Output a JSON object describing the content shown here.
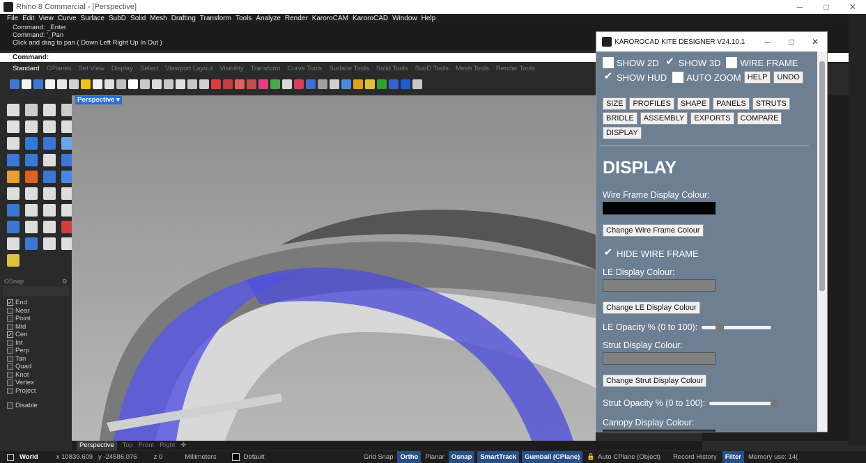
{
  "window": {
    "title": "Rhino 8 Commercial - [Perspective]",
    "min": "─",
    "max": "□",
    "close": "✕"
  },
  "menu": [
    "File",
    "Edit",
    "View",
    "Curve",
    "Surface",
    "SubD",
    "Solid",
    "Mesh",
    "Drafting",
    "Transform",
    "Tools",
    "Analyze",
    "Render",
    "KaroroCAM",
    "KaroroCAD",
    "Window",
    "Help"
  ],
  "command": {
    "history": [
      "Command: _Enter",
      "Command: '_Pan",
      "Click and drag to pan ( Down  Left  Right  Up  In  Out )"
    ],
    "prompt": "Command:"
  },
  "tabs": [
    "Standard",
    "CPlanes",
    "Set View",
    "Display",
    "Select",
    "Viewport Layout",
    "Visibility",
    "Transform",
    "Curve Tools",
    "Surface Tools",
    "Solid Tools",
    "SubD Tools",
    "Mesh Tools",
    "Render Tools"
  ],
  "toolbar_colors": [
    "#3a78d4",
    "#f2f2f2",
    "#3a78d4",
    "#f2f2f2",
    "#e8e8e8",
    "#d2d2d2",
    "#f0c020",
    "#f0f0f0",
    "#e0e0e0",
    "#c0c0c0",
    "#ffffff",
    "#c8c8c8",
    "#dcdcdc",
    "#c8c8c8",
    "#e0e0e0",
    "#c8c8c8",
    "#d0d0d0",
    "#d84040",
    "#c04040",
    "#e06060",
    "#c05050",
    "#e04080",
    "#4aa84a",
    "#d8d8d8",
    "#d84060",
    "#4070d0",
    "#a0a0a0",
    "#d0d0d0",
    "#4a8ae0",
    "#e0a020",
    "#e0c040",
    "#30a030",
    "#3a60d0",
    "#1f5ccf",
    "#c8c8c8"
  ],
  "left_colors": [
    "#ddd",
    "#ccc",
    "#ddd",
    "#ccc",
    "#e0e0e0",
    "#ddd",
    "#ddd",
    "#ddd",
    "#ddd",
    "#2f7bd8",
    "#3a78d4",
    "#6aa8e8",
    "#3a78d4",
    "#3a78d4",
    "#ddd",
    "#3a78d4",
    "#e8a030",
    "#e06020",
    "#3a78d4",
    "#4a88e8",
    "#ddd",
    "#ddd",
    "#ddd",
    "#ddd",
    "#3a78d4",
    "#ddd",
    "#ddd",
    "#ddd",
    "#3a78d4",
    "#ddd",
    "#ddd",
    "#d04040",
    "#ddd",
    "#3a78d4",
    "#ddd",
    "#ddd",
    "#e0c040"
  ],
  "viewport": {
    "label": "Perspective ▾",
    "tabs": [
      "Perspective",
      "Top",
      "Front",
      "Right",
      "✚"
    ]
  },
  "osnap": {
    "title": "OSnap",
    "gear": "⚙",
    "items": [
      {
        "label": "End",
        "checked": true
      },
      {
        "label": "Near",
        "checked": false
      },
      {
        "label": "Point",
        "checked": false
      },
      {
        "label": "Mid",
        "checked": false
      },
      {
        "label": "Cen",
        "checked": true
      },
      {
        "label": "Int",
        "checked": false
      },
      {
        "label": "Perp",
        "checked": false
      },
      {
        "label": "Tan",
        "checked": false
      },
      {
        "label": "Quad",
        "checked": false
      },
      {
        "label": "Knot",
        "checked": false
      },
      {
        "label": "Vertex",
        "checked": false
      },
      {
        "label": "Project",
        "checked": false
      }
    ],
    "disable": "Disable"
  },
  "status": {
    "cplane": "World",
    "x": "x 10839.609",
    "y": "y -24586.076",
    "z": "z 0",
    "units": "Millimeters",
    "layer": "Default",
    "grid": "Grid Snap",
    "ortho": "Ortho",
    "planar": "Planar",
    "osnap": "Osnap",
    "smart": "SmartTrack",
    "gumball": "Gumball (CPlane)",
    "autocplane": "Auto CPlane (Object)",
    "record": "Record History",
    "filter": "Filter",
    "memory": "Memory use: 14("
  },
  "plugin": {
    "title": "KAROROCAD KITE DESIGNER V24.10.1",
    "show2d": "SHOW 2D",
    "show3d": "SHOW 3D",
    "wire": "WIRE FRAME",
    "hud": "SHOW HUD",
    "autozoom": "AUTO ZOOM",
    "help": "HELP",
    "undo": "UNDO",
    "nav": [
      "SIZE",
      "PROFILES",
      "SHAPE",
      "PANELS",
      "STRUTS",
      "BRIDLE",
      "ASSEMBLY",
      "EXPORTS",
      "COMPARE",
      "DISPLAY"
    ],
    "heading": "DISPLAY",
    "wire_label": "Wire Frame Display Colour:",
    "wire_color": "#000000",
    "wire_btn": "Change Wire Frame Colour",
    "hide_wire": "HIDE WIRE FRAME",
    "le_label": "LE Display Colour:",
    "le_color": "#808080",
    "le_btn": "Change LE Display Colour",
    "le_opacity": "LE Opacity % (0 to 100):",
    "le_opacity_value": 22,
    "strut_label": "Strut Display Colour:",
    "strut_color": "#808080",
    "strut_btn": "Change Strut Display Colour",
    "strut_opacity": "Strut Opacity % (0 to 100):",
    "strut_opacity_value": 100,
    "canopy_label": "Canopy Display Colour:",
    "canopy_color": "#2a2a2a"
  }
}
